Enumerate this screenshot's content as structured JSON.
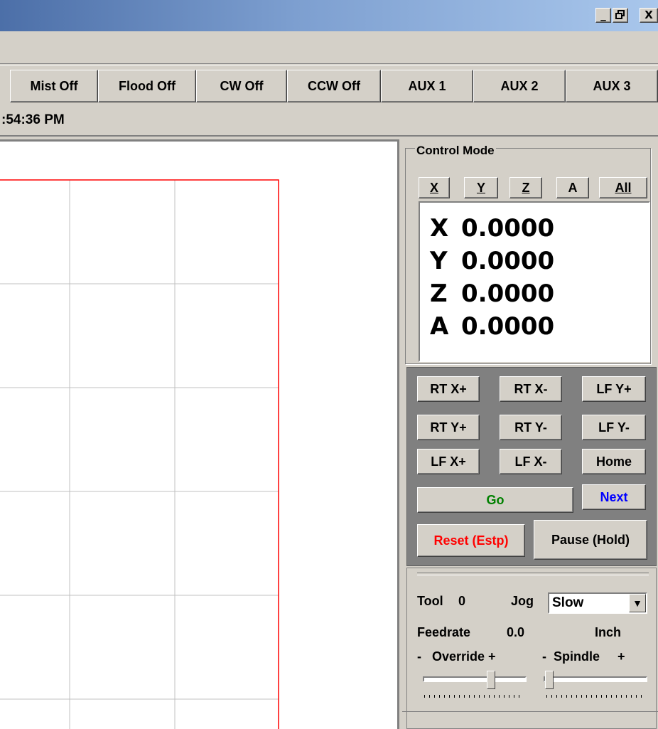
{
  "window": {
    "minimize_glyph": "_",
    "restore_glyph": "Δ",
    "close_glyph": "X"
  },
  "toolbar": {
    "buttons": [
      "Mist Off",
      "Flood Off",
      "CW Off",
      "CCW Off",
      "AUX 1",
      "AUX 2",
      "AUX 3"
    ]
  },
  "status": {
    "time": ":54:36 PM"
  },
  "plot": {
    "border_color": "#ff0000",
    "grid_color": "#c0c0c0"
  },
  "control_mode": {
    "title": "Control Mode",
    "axis_buttons": [
      "X",
      "Y",
      "Z",
      "A",
      "All"
    ]
  },
  "dro": {
    "rows": [
      {
        "axis": "X",
        "value": "0.0000"
      },
      {
        "axis": "Y",
        "value": "0.0000"
      },
      {
        "axis": "Z",
        "value": "0.0000"
      },
      {
        "axis": "A",
        "value": "0.0000"
      }
    ]
  },
  "jog": {
    "buttons": [
      "RT X+",
      "RT X-",
      "LF Y+",
      "RT Y+",
      "RT Y-",
      "LF Y-",
      "LF X+",
      "LF X-",
      "Home"
    ],
    "go": "Go",
    "next": "Next",
    "reset": "Reset (Estp)",
    "pause": "Pause (Hold)",
    "go_color": "#008000",
    "next_color": "#0000ff",
    "reset_color": "#ff0000"
  },
  "settings": {
    "tool_label": "Tool",
    "tool_value": "0",
    "jog_label": "Jog",
    "jog_value": "Slow",
    "feedrate_label": "Feedrate",
    "feedrate_value": "0.0",
    "units": "Inch",
    "override_label": "-   Override +",
    "spindle_label": "-  Spindle     +"
  }
}
